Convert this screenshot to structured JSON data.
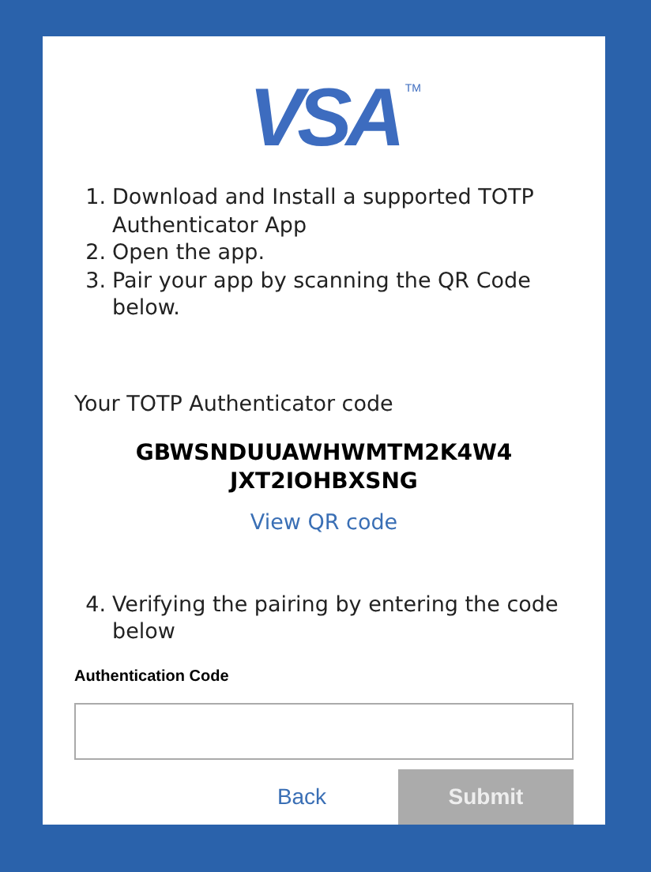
{
  "logo": {
    "text": "VSA",
    "mark": "TM"
  },
  "steps": [
    {
      "number": "1.",
      "text": "Download and Install a supported TOTP Authenticator App"
    },
    {
      "number": "2.",
      "text": "Open the app."
    },
    {
      "number": "3.",
      "text": "Pair your app by scanning the QR Code below."
    }
  ],
  "code_label": "Your TOTP Authenticator code",
  "code_lines": [
    "GBWSNDUUAWHWMTM2K4W4",
    "JXT2IOHBXSNG"
  ],
  "qr_link": "View QR code",
  "verify_step": {
    "number": "4.",
    "text": "Verifying the pairing by entering the code below"
  },
  "field": {
    "label": "Authentication Code"
  },
  "buttons": [
    {
      "kind": "link",
      "label": "Back",
      "disabled": false
    },
    {
      "kind": "primary",
      "label": "Submit",
      "disabled": true
    }
  ]
}
